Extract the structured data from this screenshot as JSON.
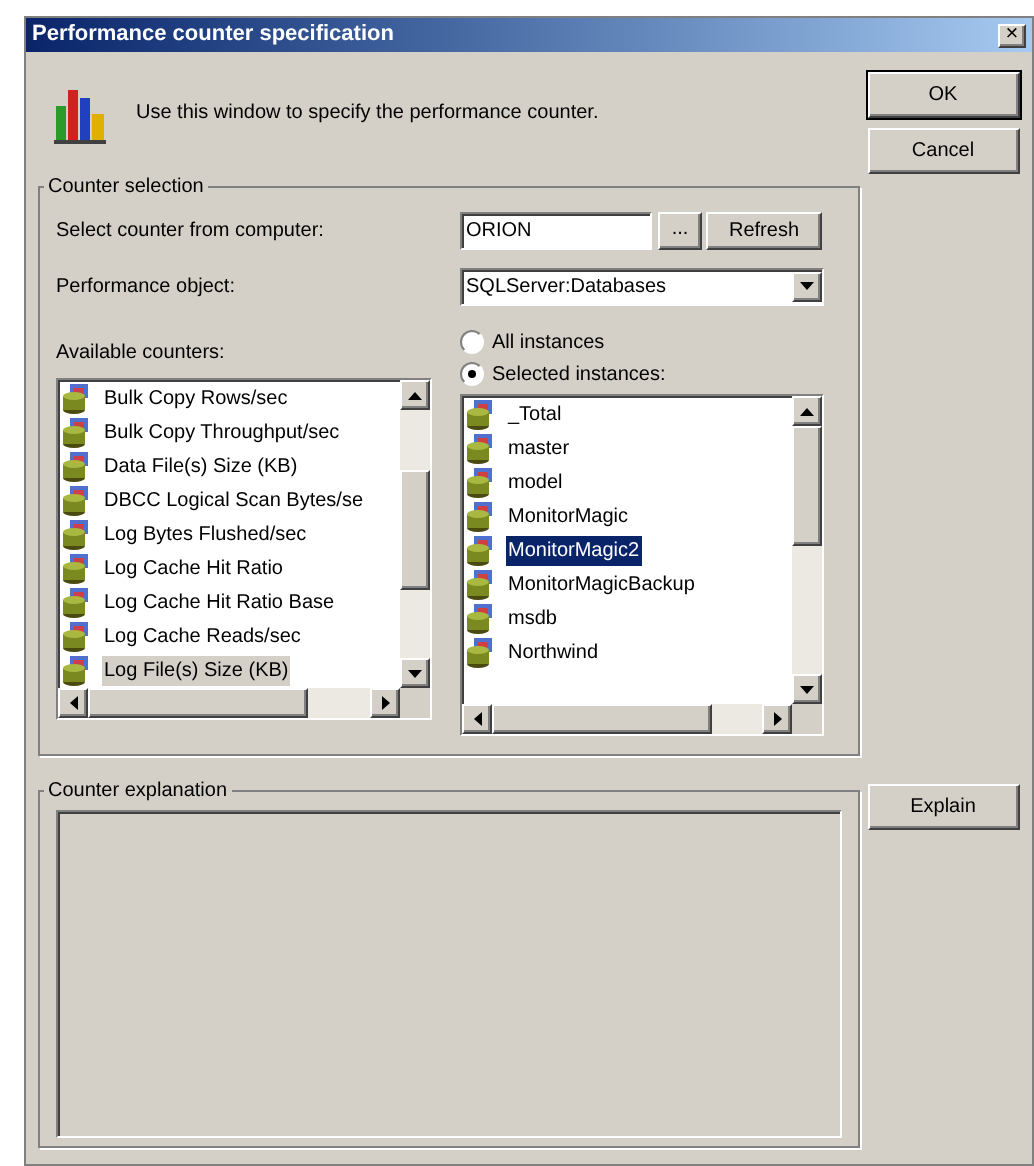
{
  "window": {
    "title": "Performance counter specification",
    "close": "×"
  },
  "intro": "Use this window to specify the performance counter.",
  "buttons": {
    "ok": "OK",
    "cancel": "Cancel",
    "explain": "Explain"
  },
  "counter_selection": {
    "title": "Counter selection",
    "computer_label": "Select counter from computer:",
    "computer_value": "ORION",
    "browse": "...",
    "refresh": "Refresh",
    "object_label": "Performance object:",
    "object_value": "SQLServer:Databases",
    "counters_label": "Available counters:",
    "counters": {
      "focused": false,
      "items": [
        {
          "label": "Bulk Copy Rows/sec",
          "selected": false
        },
        {
          "label": "Bulk Copy Throughput/sec",
          "selected": false
        },
        {
          "label": "Data File(s) Size (KB)",
          "selected": false
        },
        {
          "label": "DBCC Logical Scan Bytes/se",
          "selected": false
        },
        {
          "label": "Log Bytes Flushed/sec",
          "selected": false
        },
        {
          "label": "Log Cache Hit Ratio",
          "selected": false
        },
        {
          "label": "Log Cache Hit Ratio Base",
          "selected": false
        },
        {
          "label": "Log Cache Reads/sec",
          "selected": false
        },
        {
          "label": "Log File(s) Size (KB)",
          "selected": true
        }
      ]
    },
    "instance_options": [
      {
        "label": "All instances",
        "selected": false
      },
      {
        "label": "Selected instances:",
        "selected": true
      }
    ],
    "instances": {
      "focused": true,
      "items": [
        {
          "label": "_Total",
          "selected": false
        },
        {
          "label": "master",
          "selected": false
        },
        {
          "label": "model",
          "selected": false
        },
        {
          "label": "MonitorMagic",
          "selected": false
        },
        {
          "label": "MonitorMagic2",
          "selected": true
        },
        {
          "label": "MonitorMagicBackup",
          "selected": false
        },
        {
          "label": "msdb",
          "selected": false
        },
        {
          "label": "Northwind",
          "selected": false
        }
      ]
    }
  },
  "counter_explanation": {
    "title": "Counter explanation"
  }
}
